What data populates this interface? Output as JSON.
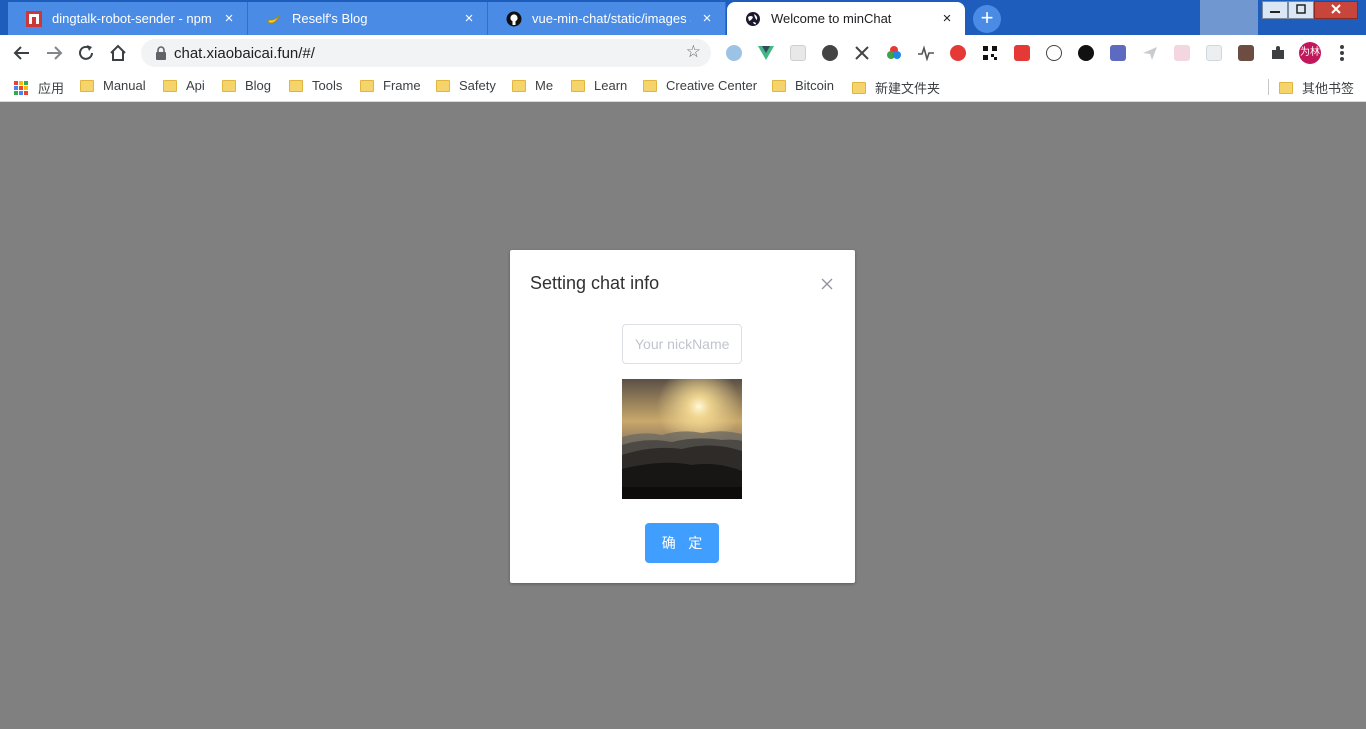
{
  "browser": {
    "tabs": [
      {
        "title": "dingtalk-robot-sender - npm",
        "favicon": "npm-icon",
        "active": false
      },
      {
        "title": "Reself's Blog",
        "favicon": "banana-icon",
        "active": false
      },
      {
        "title": "vue-min-chat/static/images at",
        "favicon": "github-icon",
        "active": false
      },
      {
        "title": "Welcome to minChat",
        "favicon": "globe-icon",
        "active": true
      }
    ],
    "close_glyph": "×",
    "new_tab_glyph": "+",
    "address": "chat.xiaobaicai.fun/#/",
    "profile_label": "为林",
    "bookmarks": {
      "apps_label": "应用",
      "folders": [
        "Manual",
        "Api",
        "Blog",
        "Tools",
        "Frame",
        "Safety",
        "Me",
        "Learn",
        "Creative Center",
        "Bitcoin",
        "新建文件夹"
      ],
      "other": "其他书签"
    }
  },
  "modal": {
    "title": "Setting chat info",
    "nickname_placeholder": "Your nickName",
    "nickname_value": "",
    "avatar_icon": "sunrise-mountain-image",
    "confirm_label": "确 定"
  },
  "colors": {
    "tabstrip": "#1f5dbd",
    "overlay": "#808080",
    "primary_button": "#409eff"
  }
}
